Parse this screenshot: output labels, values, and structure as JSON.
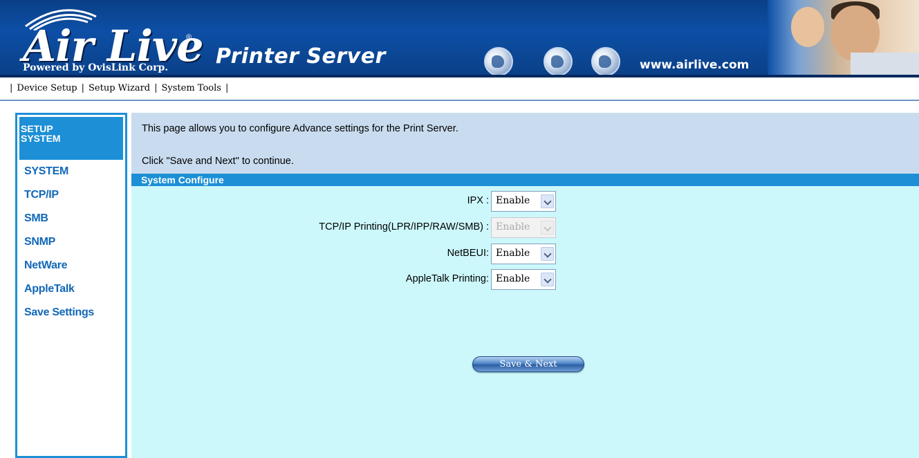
{
  "header": {
    "logo_text": "Air Live",
    "logo_registered": "®",
    "logo_subtitle": "Powered by OvisLink Corp.",
    "product_title": "Printer Server",
    "site_url": "www.airlive.com"
  },
  "topnav": {
    "separator": "|",
    "items": [
      "Device Setup",
      "Setup Wizard",
      "System Tools"
    ]
  },
  "sidebar": {
    "header_line1": "SETUP",
    "header_line2": "SYSTEM",
    "items": [
      "SYSTEM",
      "TCP/IP",
      "SMB",
      "SNMP",
      "NetWare",
      "AppleTalk",
      "Save Settings"
    ]
  },
  "main": {
    "intro_line1": "This page allows you to configure Advance settings for the Print Server.",
    "intro_line2": "Click \"Save and Next\" to continue.",
    "section_title": "System Configure",
    "fields": [
      {
        "label": "IPX :",
        "value": "Enable",
        "disabled": false
      },
      {
        "label": "TCP/IP Printing(LPR/IPP/RAW/SMB) :",
        "value": "Enable",
        "disabled": true
      },
      {
        "label": "NetBEUI:",
        "value": "Enable",
        "disabled": false
      },
      {
        "label": "AppleTalk Printing:",
        "value": "Enable",
        "disabled": false
      }
    ],
    "save_button": "Save & Next"
  },
  "colors": {
    "banner_blue": "#0d4fa6",
    "sidebar_accent": "#1c8fd6",
    "link_blue": "#1167b8",
    "content_bg": "#ccf8fc",
    "intro_bg": "#c9dcef"
  }
}
